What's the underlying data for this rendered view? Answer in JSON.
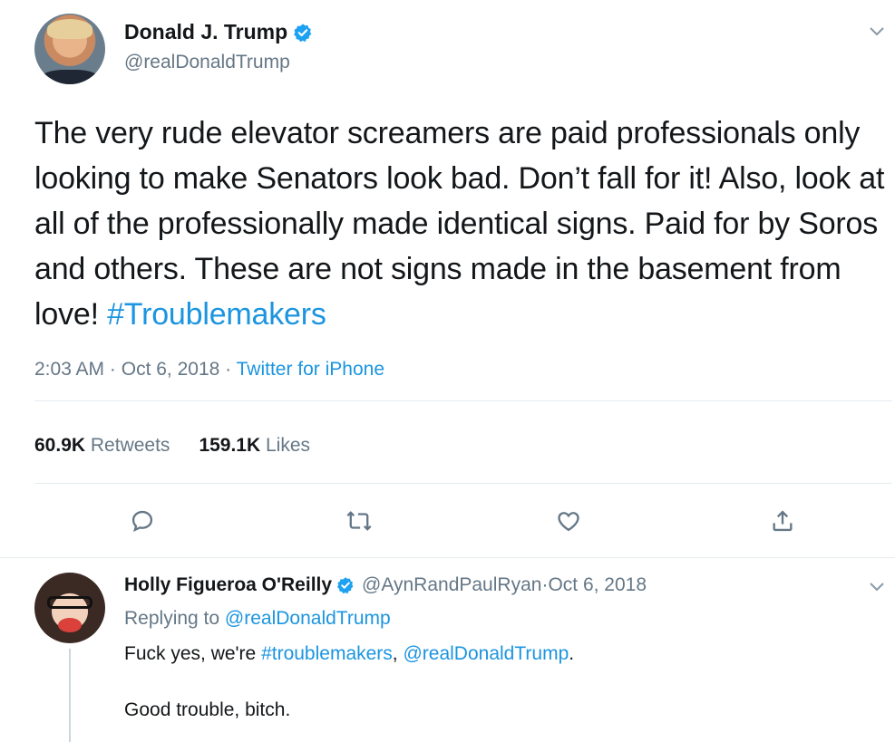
{
  "tweet": {
    "display_name": "Donald J. Trump",
    "handle": "@realDonaldTrump",
    "text": "The very rude elevator screamers are paid professionals only looking to make Senators look bad. Don’t fall for it! Also, look at all of the professionally made identical signs. Paid for by Soros and others. These are not signs made in the basement from love! ",
    "hashtag": "#Troublemakers",
    "time": "2:03 AM",
    "date": "Oct 6, 2018",
    "separator": " · ",
    "source": "Twitter for iPhone",
    "retweets_count": "60.9K",
    "retweets_label": "Retweets",
    "likes_count": "159.1K",
    "likes_label": "Likes",
    "icons": [
      "reply-icon",
      "retweet-icon",
      "like-icon",
      "share-icon"
    ]
  },
  "reply": {
    "display_name": "Holly Figueroa O'Reilly",
    "handle": "@AynRandPaulRyan",
    "separator": " · ",
    "date": "Oct 6, 2018",
    "replying_label": "Replying to ",
    "replying_to": "@realDonaldTrump",
    "text_prefix": "Fuck yes, we're ",
    "text_hashtag": "#troublemakers",
    "text_mid": ", ",
    "text_mention": "@realDonaldTrump",
    "text_suffix": ".",
    "text_line2": "Good trouble, bitch."
  },
  "colors": {
    "link": "#1b95e0",
    "muted": "#657786",
    "text": "#14171a",
    "divider": "#e6ecf0"
  }
}
